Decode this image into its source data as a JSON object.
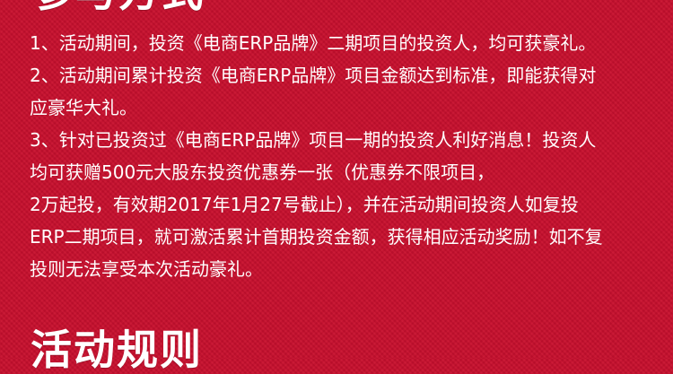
{
  "top_heading": "参与方式",
  "items": [
    {
      "lines": [
        "1、活动期间，投资《电商ERP品牌》二期项目的投资人，均可获豪礼。"
      ]
    },
    {
      "lines": [
        "2、活动期间累计投资《电商ERP品牌》项目金额达到标准，即能获得对",
        "应豪华大礼。"
      ]
    },
    {
      "lines": [
        "3、针对已投资过《电商ERP品牌》项目一期的投资人利好消息！投资人",
        "均可获赠500元大股东投资优惠券一张（优惠券不限项目，",
        "2万起投，有效期2017年1月27号截止），并在活动期间投资人如复投",
        "ERP二期项目，就可激活累计首期投资金额，获得相应活动奖励！如不复",
        "投则无法享受本次活动豪礼。"
      ]
    }
  ],
  "bottom_heading": "活动规则",
  "colors": {
    "background": "#c8102e",
    "text": "#ffffff"
  }
}
